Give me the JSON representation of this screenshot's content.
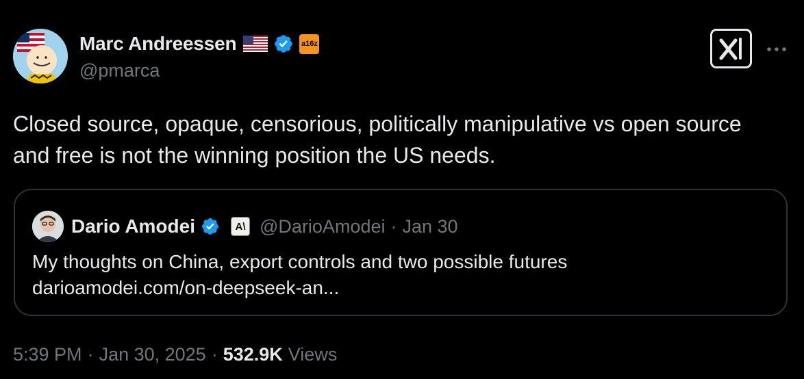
{
  "author": {
    "display_name": "Marc Andreessen",
    "handle": "@pmarca",
    "flag_icon": "us-flag-icon",
    "verified_icon": "verified-badge-icon",
    "affiliate_badge": "a16z",
    "avatar": "avatar-charlie-brown-with-flag"
  },
  "tweet": {
    "text": "Closed source, opaque, censorious, politically manipulative vs open source and free is not the winning position the US needs."
  },
  "quoted_tweet": {
    "display_name": "Dario Amodei",
    "handle": "@DarioAmodei",
    "separator": "·",
    "date": "Jan 30",
    "affiliate_badge": "A\\",
    "text_line1": "My thoughts on China, export controls and two possible futures",
    "text_line2": "darioamodei.com/on-deepseek-an..."
  },
  "footer": {
    "time": "5:39 PM",
    "separator1": "·",
    "date": "Jan 30, 2025",
    "separator2": "·",
    "views_count": "532.9K",
    "views_label": "Views"
  },
  "colors": {
    "background": "#000000",
    "text": "#e7e9ea",
    "muted": "#71767b",
    "verified": "#1d9bf0",
    "border": "#2f3336"
  }
}
